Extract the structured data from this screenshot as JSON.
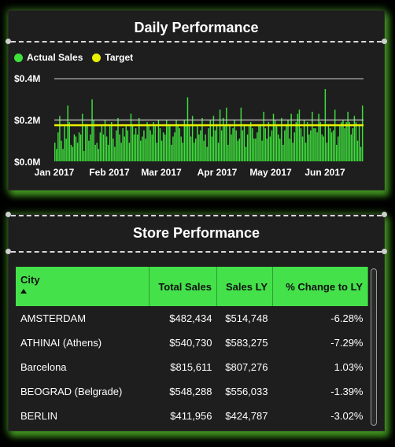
{
  "daily": {
    "title": "Daily Performance",
    "legend": [
      {
        "label": "Actual Sales",
        "color": "#3ee03c"
      },
      {
        "label": "Target",
        "color": "#e8f000"
      }
    ]
  },
  "chart_data": {
    "type": "bar",
    "x_labels": [
      "Jan 2017",
      "Feb 2017",
      "Mar 2017",
      "Apr 2017",
      "May 2017",
      "Jun 2017"
    ],
    "y_ticks": [
      "$0.4M",
      "$0.2M",
      "$0.0M"
    ],
    "ylim": [
      0,
      0.4
    ],
    "y_unit": "$M",
    "series": [
      {
        "name": "Actual Sales",
        "color": "#3ee03c",
        "values": [
          0.09,
          0.06,
          0.14,
          0.22,
          0.1,
          0.06,
          0.17,
          0.11,
          0.27,
          0.19,
          0.08,
          0.07,
          0.13,
          0.12,
          0.09,
          0.14,
          0.13,
          0.23,
          0.05,
          0.18,
          0.18,
          0.1,
          0.13,
          0.3,
          0.2,
          0.08,
          0.09,
          0.06,
          0.14,
          0.17,
          0.13,
          0.2,
          0.12,
          0.08,
          0.17,
          0.19,
          0.11,
          0.07,
          0.15,
          0.21,
          0.13,
          0.09,
          0.16,
          0.12,
          0.17,
          0.15,
          0.09,
          0.23,
          0.18,
          0.13,
          0.16,
          0.13,
          0.21,
          0.1,
          0.12,
          0.15,
          0.11,
          0.19,
          0.17,
          0.15,
          0.13,
          0.19,
          0.17,
          0.09,
          0.2,
          0.16,
          0.1,
          0.14,
          0.13,
          0.2,
          0.17,
          0.18,
          0.08,
          0.12,
          0.14,
          0.2,
          0.18,
          0.16,
          0.12,
          0.09,
          0.2,
          0.18,
          0.31,
          0.17,
          0.12,
          0.22,
          0.09,
          0.11,
          0.17,
          0.13,
          0.15,
          0.21,
          0.1,
          0.13,
          0.07,
          0.16,
          0.2,
          0.12,
          0.22,
          0.15,
          0.18,
          0.09,
          0.25,
          0.15,
          0.21,
          0.17,
          0.26,
          0.08,
          0.18,
          0.13,
          0.16,
          0.2,
          0.15,
          0.1,
          0.11,
          0.26,
          0.15,
          0.18,
          0.07,
          0.13,
          0.17,
          0.19,
          0.16,
          0.11,
          0.11,
          0.14,
          0.18,
          0.18,
          0.1,
          0.24,
          0.16,
          0.11,
          0.19,
          0.12,
          0.15,
          0.23,
          0.2,
          0.17,
          0.13,
          0.11,
          0.21,
          0.08,
          0.15,
          0.18,
          0.2,
          0.11,
          0.23,
          0.09,
          0.14,
          0.19,
          0.23,
          0.25,
          0.16,
          0.12,
          0.2,
          0.09,
          0.19,
          0.13,
          0.15,
          0.24,
          0.16,
          0.16,
          0.14,
          0.23,
          0.19,
          0.13,
          0.12,
          0.35,
          0.09,
          0.18,
          0.16,
          0.14,
          0.15,
          0.25,
          0.08,
          0.12,
          0.17,
          0.19,
          0.2,
          0.16,
          0.19,
          0.24,
          0.19,
          0.13,
          0.16,
          0.22,
          0.19,
          0.1,
          0.18,
          0.07,
          0.27
        ]
      },
      {
        "name": "Target",
        "color": "#e8f000",
        "value": 0.175
      }
    ],
    "reference_line": 0.2,
    "grid": false,
    "legend_position": "top-left"
  },
  "store": {
    "title": "Store Performance",
    "columns": [
      "City",
      "Total Sales",
      "Sales LY",
      "% Change to LY"
    ],
    "rows": [
      [
        "AMSTERDAM",
        "$482,434",
        "$514,748",
        "-6.28%"
      ],
      [
        "ATHINAI (Athens)",
        "$540,730",
        "$583,275",
        "-7.29%"
      ],
      [
        "Barcelona",
        "$815,611",
        "$807,276",
        "1.03%"
      ],
      [
        "BEOGRAD (Belgrade)",
        "$548,288",
        "$556,033",
        "-1.39%"
      ],
      [
        "BERLIN",
        "$411,956",
        "$424,787",
        "-3.02%"
      ]
    ]
  }
}
